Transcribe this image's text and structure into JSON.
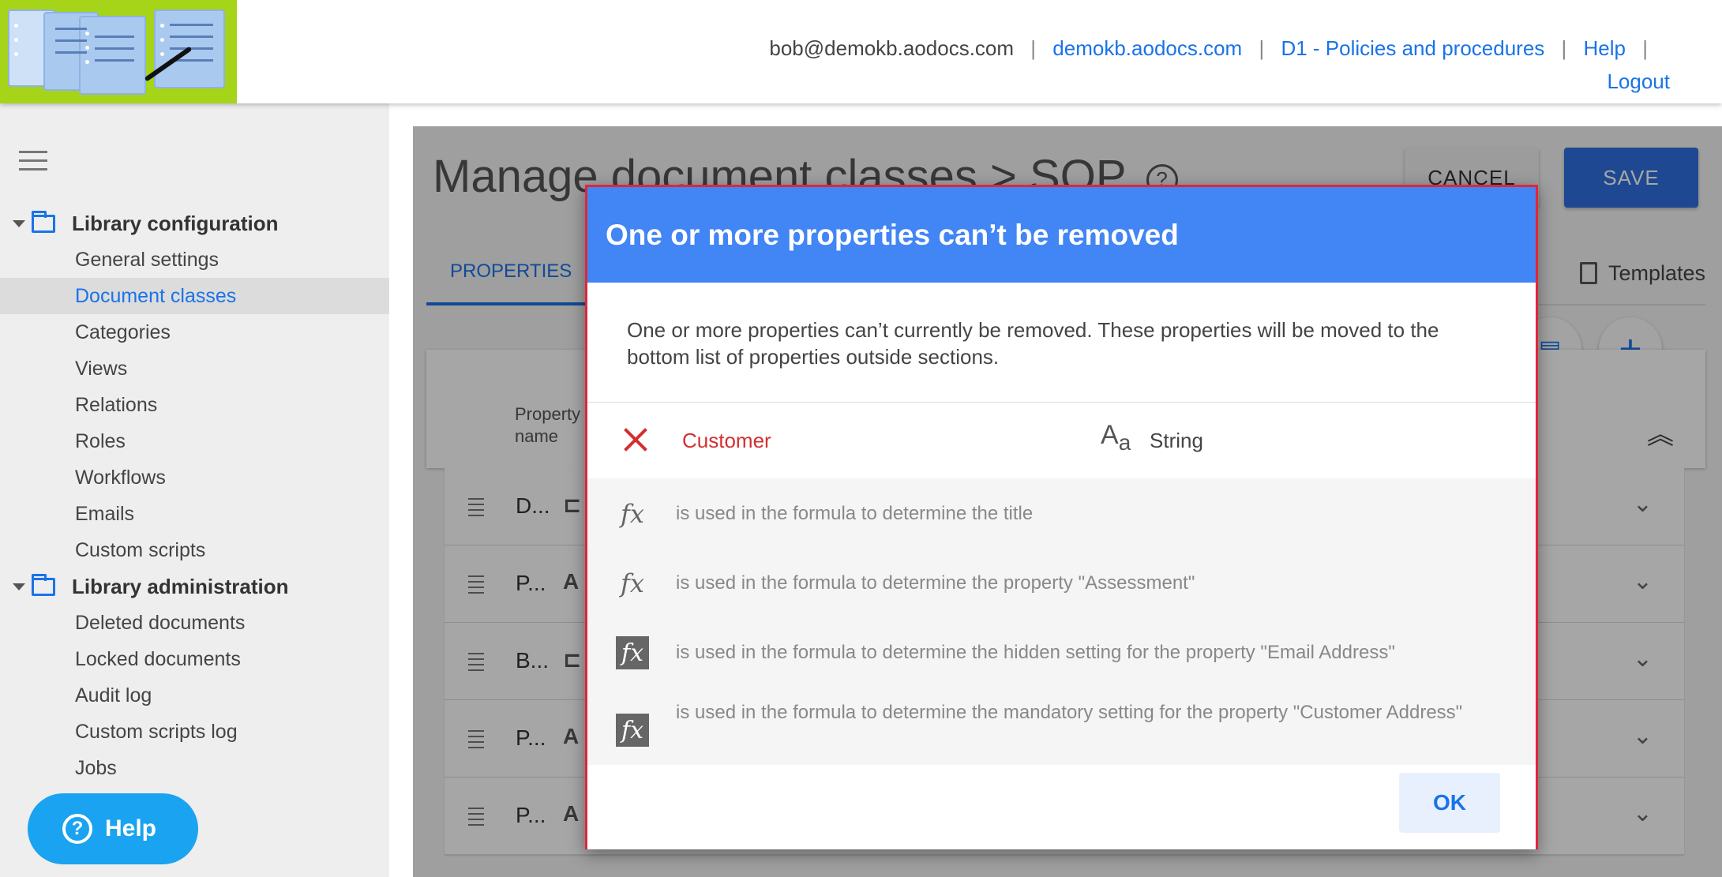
{
  "header": {
    "email": "bob@demokb.aodocs.com",
    "domain_link": "demokb.aodocs.com",
    "library_link": "D1 - Policies and procedures",
    "help_link": "Help",
    "logout_link": "Logout"
  },
  "sidebar": {
    "groups": [
      {
        "label": "Library configuration",
        "items": [
          "General settings",
          "Document classes",
          "Categories",
          "Views",
          "Relations",
          "Roles",
          "Workflows",
          "Emails",
          "Custom scripts"
        ]
      },
      {
        "label": "Library administration",
        "items": [
          "Deleted documents",
          "Locked documents",
          "Audit log",
          "Custom scripts log",
          "Jobs"
        ]
      }
    ],
    "active_item": "Document classes",
    "help_button": "Help"
  },
  "main": {
    "title": "Manage document classes > SOP",
    "cancel_label": "CANCEL",
    "save_label": "SAVE",
    "tabs": {
      "properties": "PROPERTIES",
      "templates": "Templates"
    },
    "table": {
      "column_property_name": "Property name",
      "rows": [
        {
          "name": "D...",
          "type_icon": "tree-icon"
        },
        {
          "name": "P...",
          "type_icon": "string-type-icon"
        },
        {
          "name": "B...",
          "type_icon": "tree-icon"
        },
        {
          "name": "P...",
          "type_icon": "string-type-icon"
        },
        {
          "name": "P...",
          "type_icon": "string-type-icon"
        }
      ]
    }
  },
  "dialog": {
    "title": "One or more properties can’t be removed",
    "message": "One or more properties can’t currently be removed. These properties will be moved to the bottom list of properties outside sections.",
    "property": {
      "name": "Customer",
      "type": "String"
    },
    "usages": [
      {
        "icon": "formula-icon",
        "text": "is used in the formula to determine the title"
      },
      {
        "icon": "formula-icon",
        "text": "is used in the formula to determine the property \"Assessment\""
      },
      {
        "icon": "formula-box-icon",
        "text": "is used in the formula to determine the hidden setting for the property \"Email Address\""
      },
      {
        "icon": "formula-box-icon",
        "text": "is used in the formula to determine the mandatory setting for the property \"Customer Address\""
      }
    ],
    "ok_label": "OK"
  },
  "colors": {
    "brand_green": "#a5d418",
    "accent_blue": "#1a73e8",
    "dialog_header": "#4285f4",
    "error_red": "#d32f2f",
    "help_button": "#1aa3f0"
  }
}
